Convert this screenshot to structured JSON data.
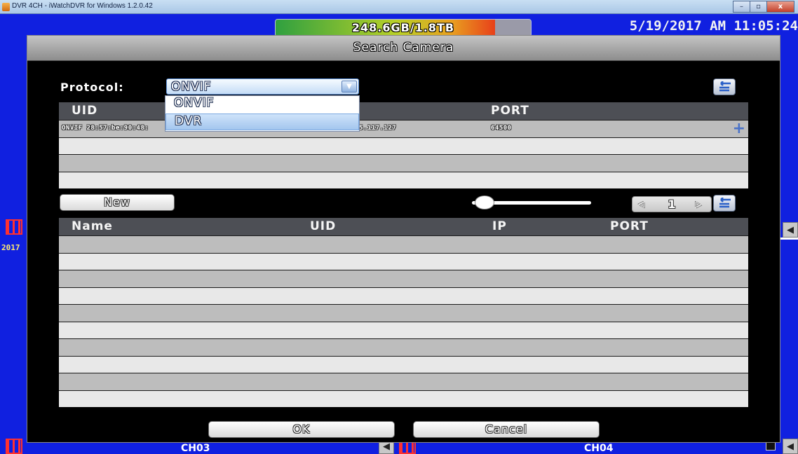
{
  "window": {
    "title": "DVR 4CH - iWatchDVR for Windows 1.2.0.42",
    "min_glyph": "–",
    "max_glyph": "▫",
    "close_glyph": "x"
  },
  "status": {
    "storage_text": "248.6GB/1.8TB",
    "storage_used_fraction": 0.86,
    "datetime": "5/19/2017 AM 11:05:24"
  },
  "side": {
    "year_label": "2017",
    "film_icon": "film-strip-icon",
    "speaker_icon": "speaker-icon",
    "speaker_glyph": "◀"
  },
  "channels": {
    "left_label": "CH03",
    "right_label": "CH04"
  },
  "dialog": {
    "title": "Search Camera",
    "protocol_label": "Protocol:",
    "protocol_value": "ONVIF",
    "dropdown_arrow_glyph": "▼",
    "protocol_options": [
      "ONVIF",
      "DVR"
    ],
    "search_table": {
      "columns": [
        "UID",
        "PORT"
      ],
      "rows": [
        {
          "uid": "ONVIF 28:57:be:90:48:",
          "ip": "5.117.127",
          "port": "64500"
        }
      ],
      "add_glyph": "+"
    },
    "new_button": "New",
    "page_number": "1",
    "prev_glyph": "◁",
    "next_glyph": "▷",
    "camera_table": {
      "columns": [
        "Name",
        "UID",
        "IP",
        "PORT"
      ]
    },
    "ok_button": "OK",
    "cancel_button": "Cancel"
  },
  "colors": {
    "desktop_blue": "#1020e0",
    "dialog_black": "#000000",
    "row_gray": "#bdbdbd",
    "row_light": "#e8e8e8",
    "header_dark": "#4d4f55"
  }
}
